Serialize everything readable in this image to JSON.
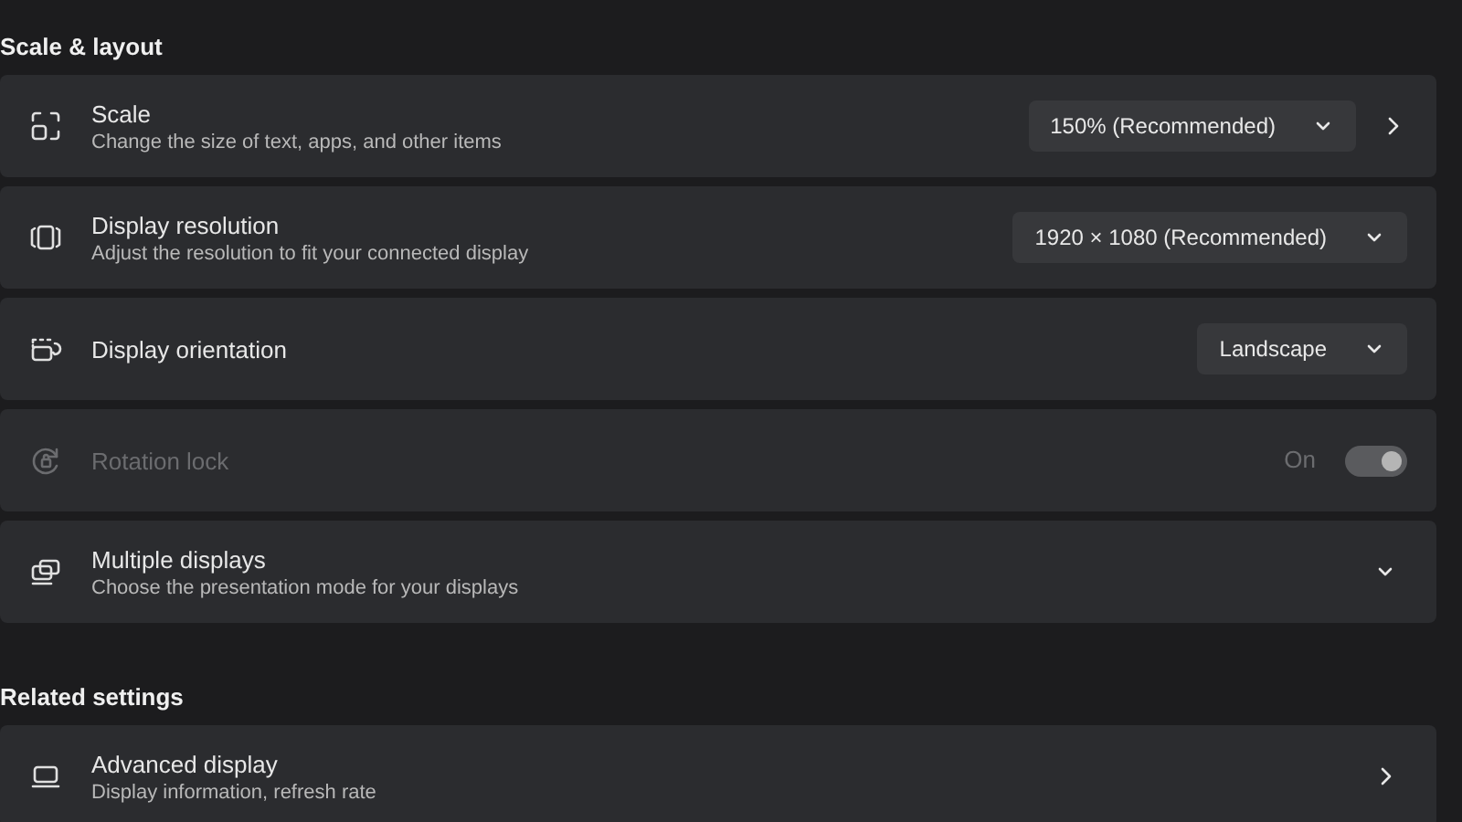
{
  "sections": [
    {
      "heading": "Scale & layout",
      "items": [
        {
          "kind": "dropdown",
          "title": "Scale",
          "subtitle": "Change the size of text, apps, and other items",
          "value": "150% (Recommended)",
          "link": true,
          "disabled": false
        },
        {
          "kind": "dropdown",
          "title": "Display resolution",
          "subtitle": "Adjust the resolution to fit your connected display",
          "value": "1920 × 1080 (Recommended)",
          "link": false,
          "disabled": false
        },
        {
          "kind": "dropdown",
          "title": "Display orientation",
          "value": "Landscape",
          "link": false,
          "disabled": false
        },
        {
          "kind": "toggle",
          "title": "Rotation lock",
          "state_label": "On",
          "on": true,
          "disabled": true
        },
        {
          "kind": "expand",
          "title": "Multiple displays",
          "subtitle": "Choose the presentation mode for your displays",
          "expanded": false,
          "disabled": false
        }
      ]
    },
    {
      "heading": "Related settings",
      "items": [
        {
          "kind": "link",
          "title": "Advanced display",
          "subtitle": "Display information, refresh rate",
          "disabled": false
        }
      ]
    }
  ]
}
